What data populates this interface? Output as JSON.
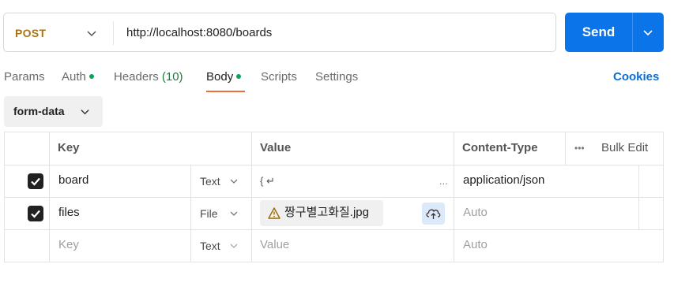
{
  "request": {
    "method": "POST",
    "url": "http://localhost:8080/boards",
    "send_label": "Send"
  },
  "tabs": [
    {
      "label": "Params"
    },
    {
      "label": "Auth"
    },
    {
      "label": "Headers",
      "count": "(10)"
    },
    {
      "label": "Body"
    },
    {
      "label": "Scripts"
    },
    {
      "label": "Settings"
    }
  ],
  "cookies_label": "Cookies",
  "body_type": "form-data",
  "table": {
    "headers": {
      "key": "Key",
      "value": "Value",
      "content_type": "Content-Type",
      "bulk_edit": "Bulk Edit",
      "more": "•••"
    },
    "rows": [
      {
        "key": "board",
        "type": "Text",
        "value": "{ ↵",
        "value_more": "...",
        "content_type": "application/json"
      },
      {
        "key": "files",
        "type": "File",
        "value": "짱구별고화질.jpg",
        "content_type": "Auto"
      }
    ],
    "empty_row": {
      "key": "Key",
      "type": "Text",
      "value": "Value",
      "content_type": "Auto"
    }
  },
  "colors": {
    "send": "#0b74e8",
    "method": "#a97417",
    "active_underline": "#f26b3a",
    "dot": "#0aa35a",
    "cookies": "#0b6fd8"
  }
}
